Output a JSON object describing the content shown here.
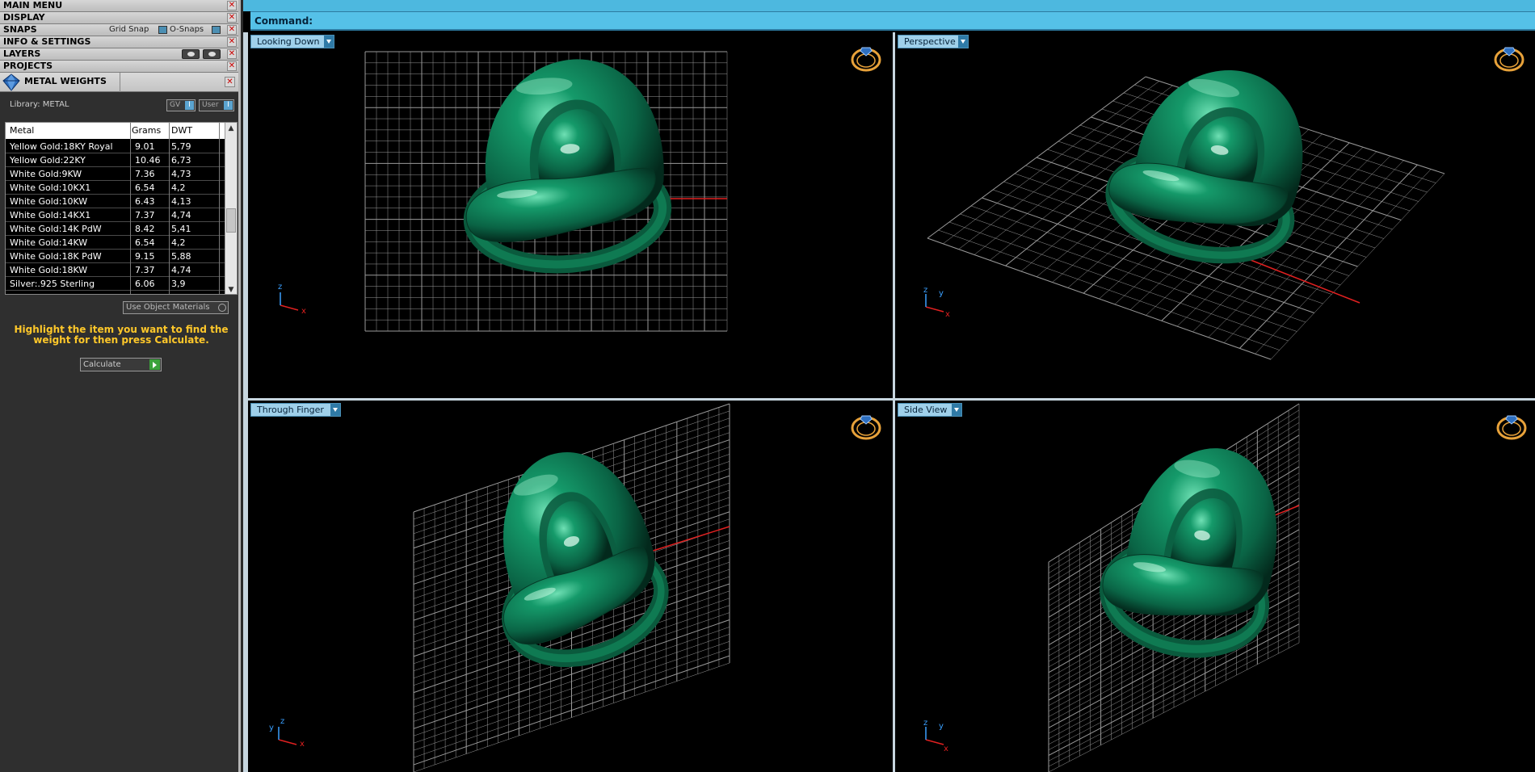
{
  "menu": {
    "items": [
      {
        "label": "MAIN MENU"
      },
      {
        "label": "DISPLAY"
      },
      {
        "label": "SNAPS",
        "grid_snap": "Grid Snap",
        "osnaps": "O-Snaps"
      },
      {
        "label": "INFO & SETTINGS"
      },
      {
        "label": "LAYERS"
      },
      {
        "label": "PROJECTS"
      }
    ]
  },
  "metal_weights": {
    "title": "METAL WEIGHTS",
    "library": "Library: METAL",
    "gv_label": "GV",
    "user_label": "User",
    "columns": [
      "Metal",
      "Grams",
      "DWT"
    ],
    "rows": [
      {
        "metal": "Yellow Gold:18KY Royal",
        "grams": "9.01",
        "dwt": "5,79"
      },
      {
        "metal": "Yellow Gold:22KY",
        "grams": "10.46",
        "dwt": "6,73"
      },
      {
        "metal": "White Gold:9KW",
        "grams": "7.36",
        "dwt": "4,73"
      },
      {
        "metal": "White Gold:10KX1",
        "grams": "6.54",
        "dwt": "4,2"
      },
      {
        "metal": "White Gold:10KW",
        "grams": "6.43",
        "dwt": "4,13"
      },
      {
        "metal": "White Gold:14KX1",
        "grams": "7.37",
        "dwt": "4,74"
      },
      {
        "metal": "White Gold:14K PdW",
        "grams": "8.42",
        "dwt": "5,41"
      },
      {
        "metal": "White Gold:14KW",
        "grams": "6.54",
        "dwt": "4,2"
      },
      {
        "metal": "White Gold:18K PdW",
        "grams": "9.15",
        "dwt": "5,88"
      },
      {
        "metal": "White Gold:18KW",
        "grams": "7.37",
        "dwt": "4,74"
      },
      {
        "metal": "Silver:.925 Sterling",
        "grams": "6.06",
        "dwt": "3,9"
      }
    ],
    "use_object_materials": "Use Object Materials",
    "hint": "Highlight the item you want to find the weight for then press Calculate.",
    "calculate": "Calculate"
  },
  "command": {
    "label": "Command:"
  },
  "viewports": {
    "top_left": "Looking Down",
    "top_right": "Perspective",
    "bottom_left": "Through Finger",
    "bottom_right": "Side View"
  },
  "axes": {
    "x": "x",
    "y": "y",
    "z": "z"
  },
  "icons": [
    "x-close-icon",
    "gem-logo-icon",
    "ring-icon",
    "dropdown-arrow-icon",
    "scroll-up-icon",
    "scroll-down-icon",
    "play-icon",
    "eye-icon"
  ],
  "colors": {
    "ring": "#0c7a55",
    "accent": "#55c1e8",
    "hint": "#ffc82a",
    "axis_x": "#e02020"
  }
}
